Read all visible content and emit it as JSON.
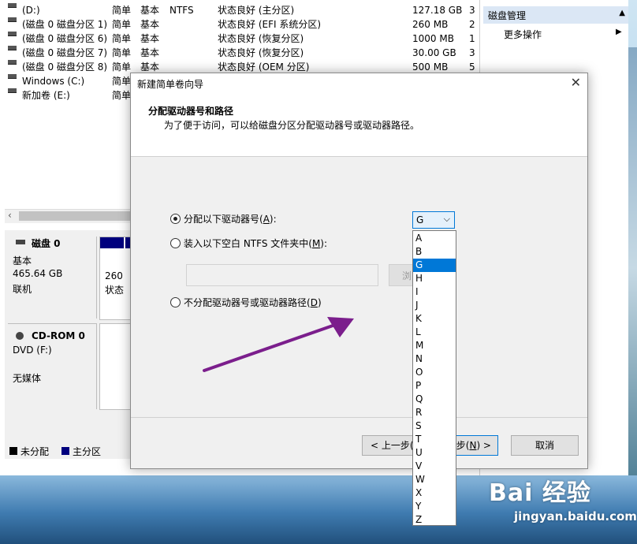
{
  "volume_list": {
    "rows": [
      {
        "name": "(D:)",
        "layout": "简单",
        "type": "基本",
        "fs": "NTFS",
        "status": "状态良好 (主分区)",
        "capacity": "127.18 GB",
        "free": "3"
      },
      {
        "name": "(磁盘 0 磁盘分区 1)",
        "layout": "简单",
        "type": "基本",
        "fs": "",
        "status": "状态良好 (EFI 系统分区)",
        "capacity": "260 MB",
        "free": "2"
      },
      {
        "name": "(磁盘 0 磁盘分区 6)",
        "layout": "简单",
        "type": "基本",
        "fs": "",
        "status": "状态良好 (恢复分区)",
        "capacity": "1000 MB",
        "free": "1"
      },
      {
        "name": "(磁盘 0 磁盘分区 7)",
        "layout": "简单",
        "type": "基本",
        "fs": "",
        "status": "状态良好 (恢复分区)",
        "capacity": "30.00 GB",
        "free": "3"
      },
      {
        "name": "(磁盘 0 磁盘分区 8)",
        "layout": "简单",
        "type": "基本",
        "fs": "",
        "status": "状态良好 (OEM 分区)",
        "capacity": "500 MB",
        "free": "5"
      },
      {
        "name": "Windows (C:)",
        "layout": "简单",
        "type": "",
        "fs": "",
        "status": "",
        "capacity": "",
        "free": ""
      },
      {
        "name": "新加卷 (E:)",
        "layout": "简单",
        "type": "",
        "fs": "",
        "status": "",
        "capacity": "",
        "free": ""
      }
    ]
  },
  "actions_pane": {
    "header": "磁盘管理",
    "more": "更多操作"
  },
  "disk0": {
    "title": "磁盘 0",
    "type": "基本",
    "size": "465.64 GB",
    "state": "联机",
    "partition_size": "260",
    "partition_status": "状态"
  },
  "cdrom": {
    "title": "CD-ROM 0",
    "drive": "DVD (F:)",
    "media": "无媒体"
  },
  "legend": {
    "unallocated": "未分配",
    "primary": "主分区"
  },
  "dialog": {
    "title": "新建简单卷向导",
    "heading": "分配驱动器号和路径",
    "subheading": "为了便于访问，可以给磁盘分区分配驱动器号或驱动器路径。",
    "option_assign_letter": "分配以下驱动器号(",
    "option_assign_letter_key": "A",
    "option_assign_letter_end": "):",
    "option_mount_folder": "装入以下空白 NTFS 文件夹中(",
    "option_mount_folder_key": "M",
    "option_mount_folder_end": "):",
    "browse_label": "浏",
    "option_no_letter": "不分配驱动器号或驱动器路径(",
    "option_no_letter_key": "D",
    "option_no_letter_end": ")",
    "selected_letter": "G",
    "back_button": "< 上一步(",
    "next_button_tail": "步(",
    "next_key": "N",
    "next_end": ") >",
    "cancel_button": "取消"
  },
  "dropdown_options": [
    "A",
    "B",
    "G",
    "H",
    "I",
    "J",
    "K",
    "L",
    "M",
    "N",
    "O",
    "P",
    "Q",
    "R",
    "S",
    "T",
    "U",
    "V",
    "W",
    "X",
    "Y",
    "Z"
  ],
  "watermark": {
    "brand": "Bai 经验",
    "url": "jingyan.baidu.com"
  },
  "colors": {
    "selection": "#0078d7",
    "primary_partition": "#00007e",
    "arrow": "#7b1e8c"
  }
}
